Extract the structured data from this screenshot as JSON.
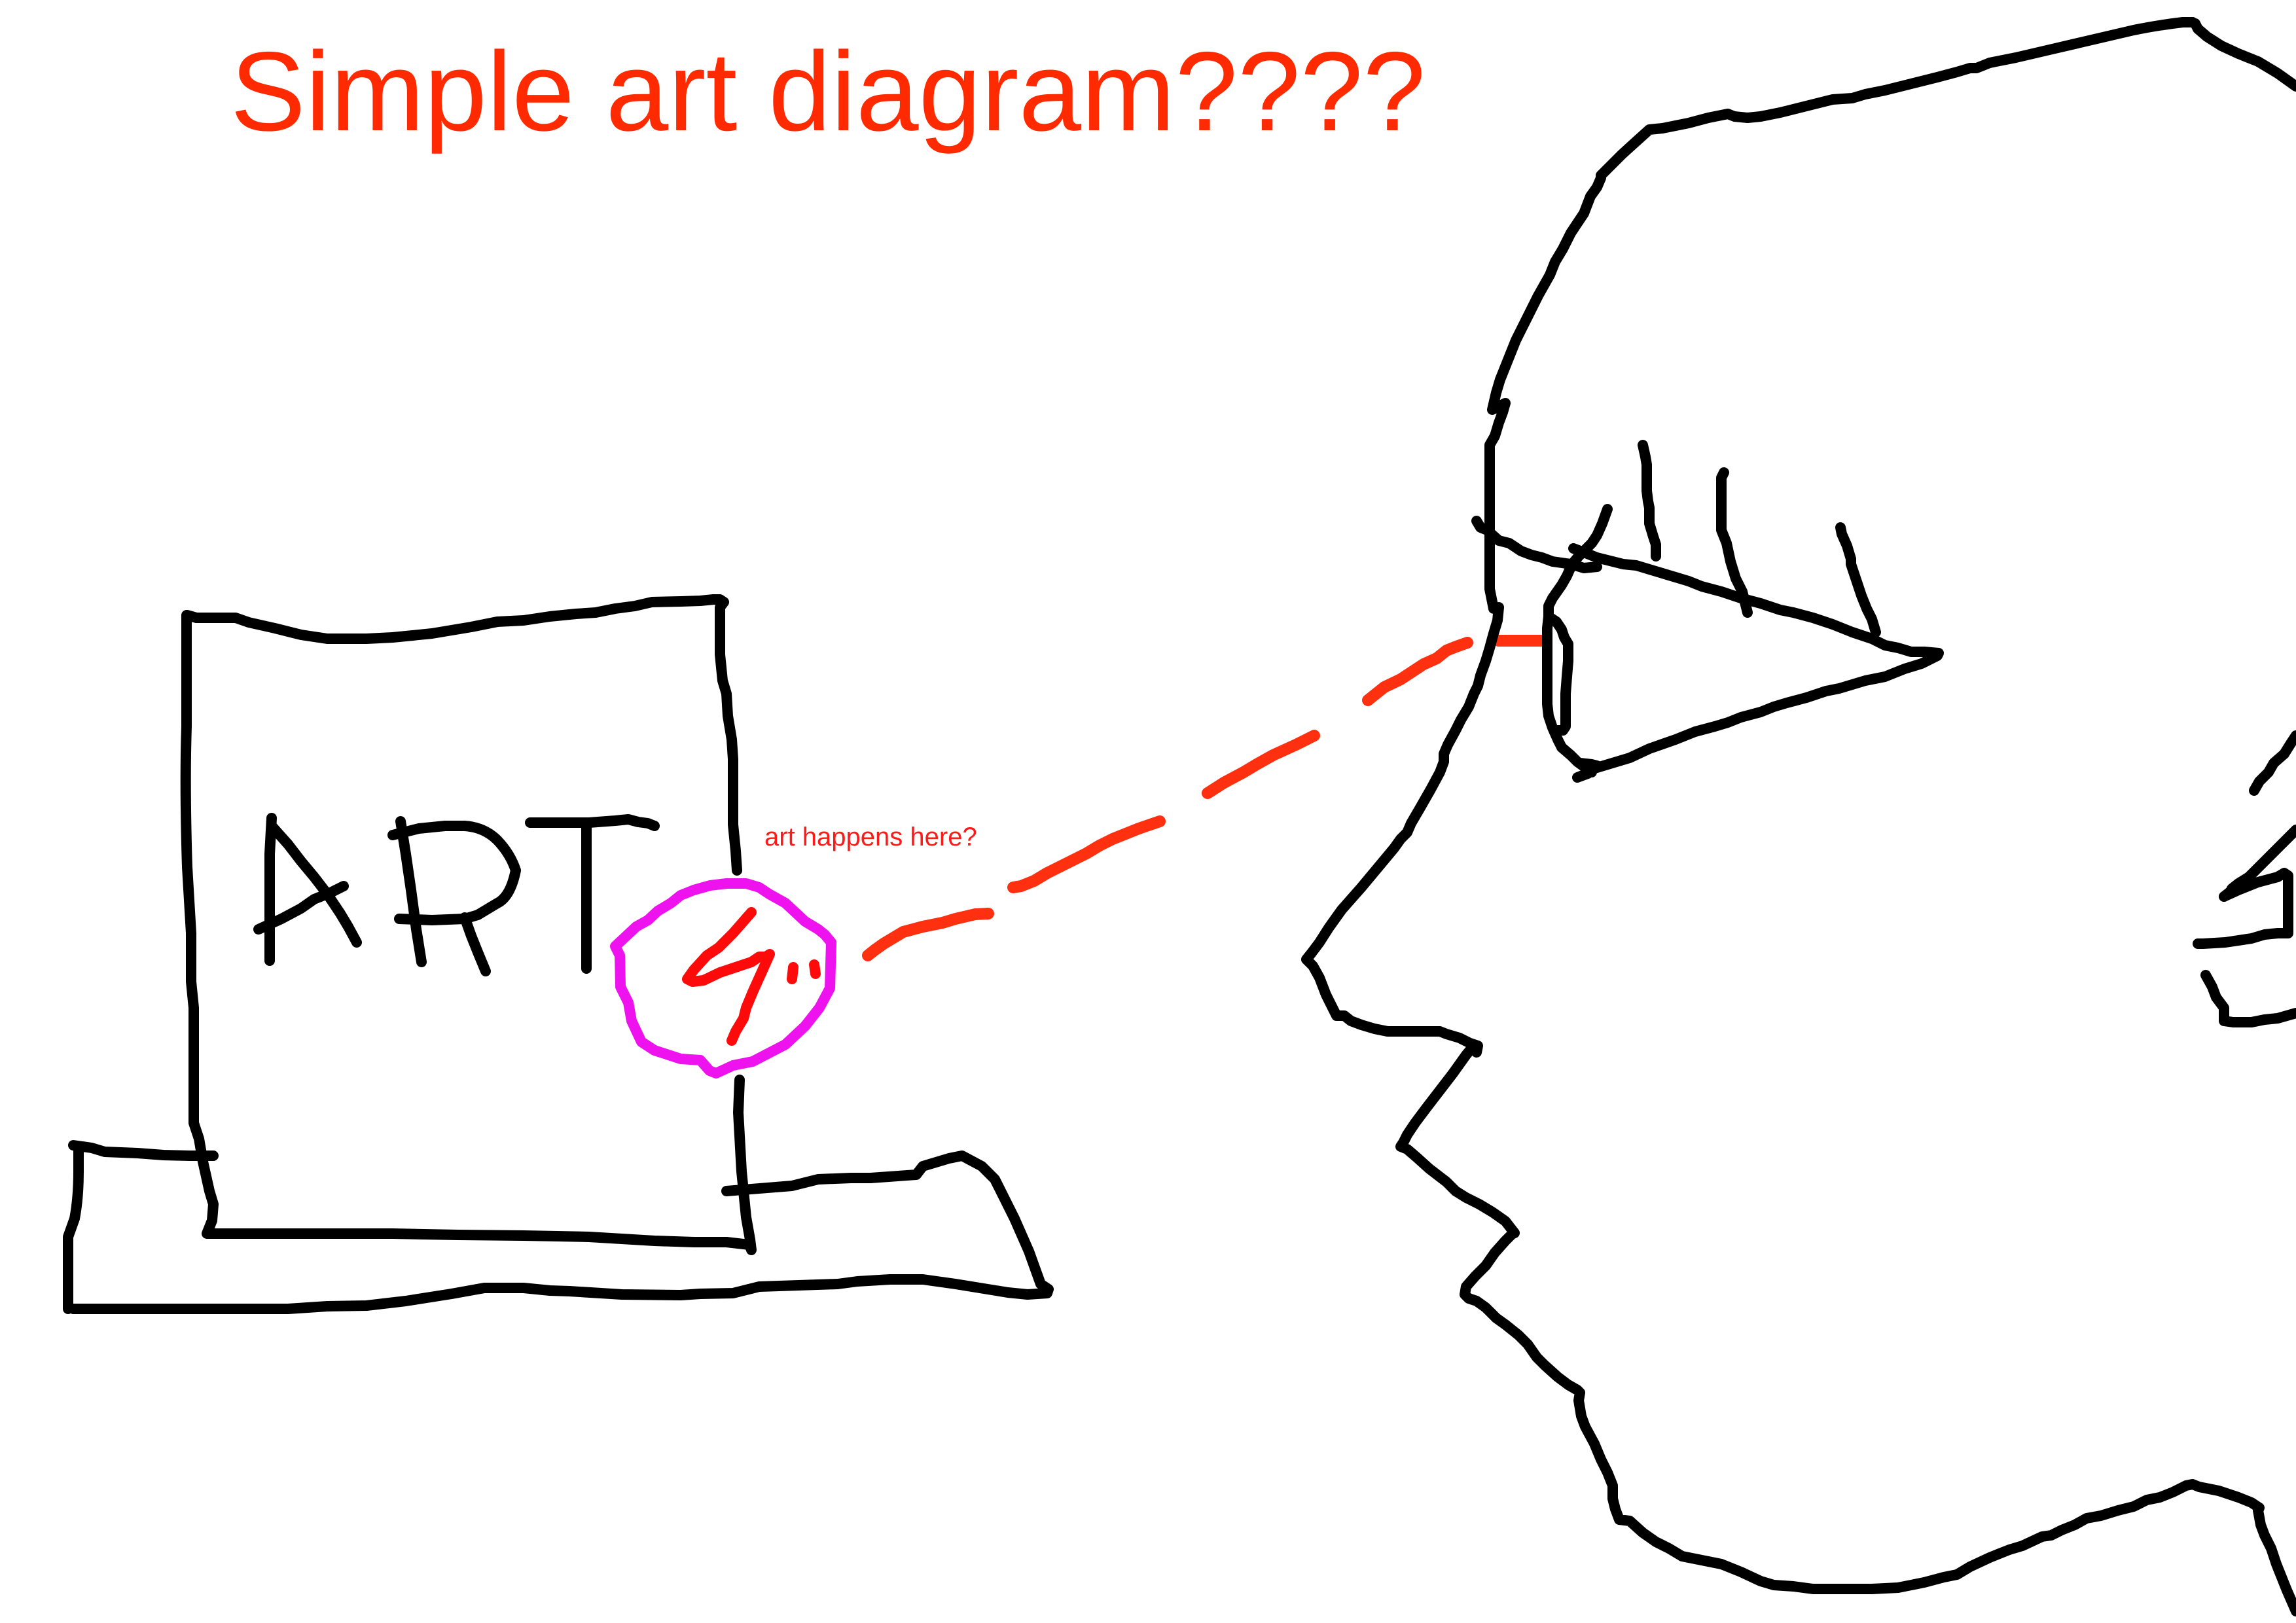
{
  "title": "Simple art diagram????",
  "painting": {
    "word": "ART"
  },
  "annotation": {
    "text": "art happens here?"
  },
  "colors": {
    "ink": "#000000",
    "title": "#ff2a00",
    "note": "#ff1a1a",
    "circle": "#ee12ee",
    "dashes": "#ff3010",
    "scribble": "#ff0a0a"
  }
}
